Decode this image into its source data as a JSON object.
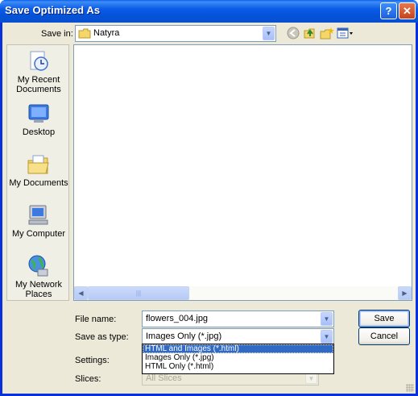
{
  "window": {
    "title": "Save Optimized As",
    "help_glyph": "?",
    "close_glyph": "✕"
  },
  "save_in": {
    "label": "Save in:",
    "value": "Natyra"
  },
  "places": [
    {
      "label": "My Recent Documents",
      "icon": "recent-documents-icon"
    },
    {
      "label": "Desktop",
      "icon": "desktop-icon"
    },
    {
      "label": "My Documents",
      "icon": "my-documents-icon"
    },
    {
      "label": "My Computer",
      "icon": "my-computer-icon"
    },
    {
      "label": "My Network Places",
      "icon": "network-places-icon"
    }
  ],
  "file_name": {
    "label": "File name:",
    "value": "flowers_004.jpg"
  },
  "save_as_type": {
    "label": "Save as type:",
    "value": "Images Only (*.jpg)",
    "options": [
      "HTML and Images (*.html)",
      "Images Only (*.jpg)",
      "HTML Only (*.html)"
    ],
    "highlighted": "HTML and Images (*.html)"
  },
  "settings": {
    "label": "Settings:"
  },
  "slices": {
    "label": "Slices:",
    "value": "All Slices"
  },
  "buttons": {
    "save": "Save",
    "cancel": "Cancel"
  },
  "colors": {
    "titlebar": "#0a5be8",
    "dialog_bg": "#ece9d8",
    "selection": "#316ac5"
  }
}
